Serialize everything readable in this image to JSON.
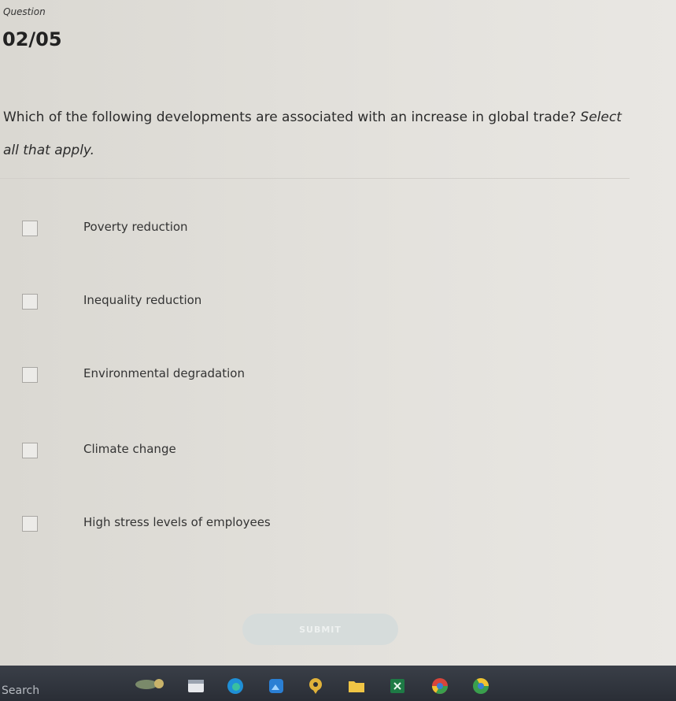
{
  "question": {
    "label": "Question",
    "counter": "02/05",
    "text": "Which of the following developments are associated with an increase in global trade?",
    "hint": "Select all that apply."
  },
  "options": [
    {
      "label": "Poverty reduction",
      "checked": false
    },
    {
      "label": "Inequality reduction",
      "checked": false
    },
    {
      "label": "Environmental degradation",
      "checked": false
    },
    {
      "label": "Climate change",
      "checked": false
    },
    {
      "label": "High stress levels of employees",
      "checked": false
    }
  ],
  "submit": {
    "label": "SUBMIT"
  },
  "taskbar": {
    "search_label": "Search",
    "icons": [
      "weather-icon",
      "file-explorer-icon",
      "edge-browser-icon",
      "photos-icon",
      "maps-icon",
      "folder-icon",
      "excel-icon",
      "chrome-icon",
      "chrome-canary-icon"
    ]
  },
  "colors": {
    "background": "#e3e1dc",
    "text": "#2b2b2b",
    "submit_disabled": "#d6dcdb",
    "taskbar": "#2f333b"
  }
}
